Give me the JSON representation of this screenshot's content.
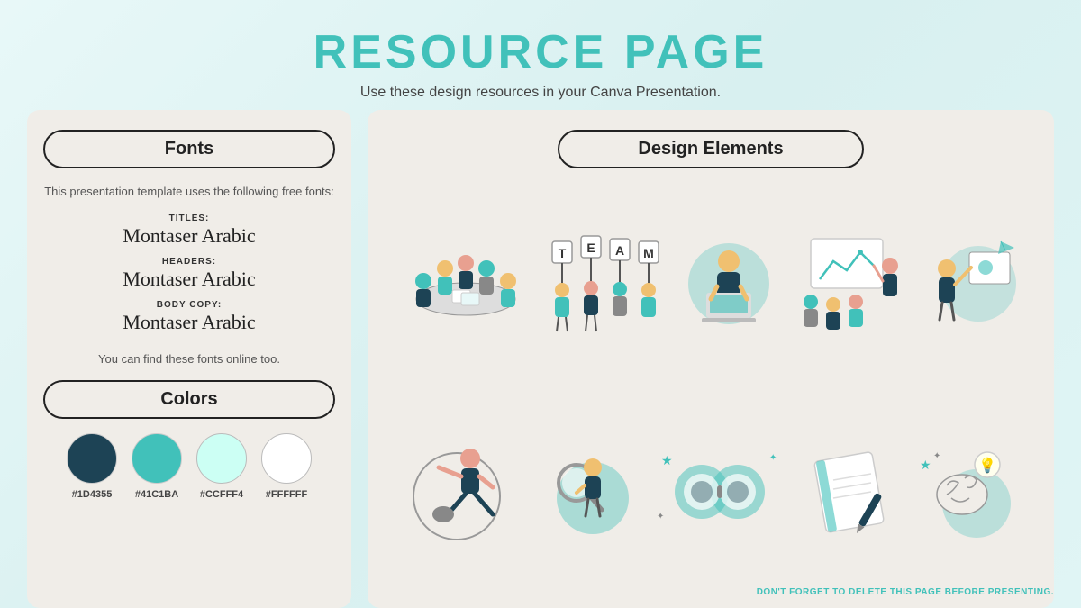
{
  "header": {
    "title": "RESOURCE PAGE",
    "subtitle": "Use these design resources in your Canva Presentation."
  },
  "left_panel": {
    "fonts_section": {
      "label": "Fonts",
      "intro": "This presentation template uses the following free fonts:",
      "entries": [
        {
          "label": "TITLES:",
          "name": "Montaser Arabic"
        },
        {
          "label": "HEADERS:",
          "name": "Montaser Arabic"
        },
        {
          "label": "BODY COPY:",
          "name": "Montaser Arabic"
        }
      ],
      "footer": "You can find these fonts online too."
    },
    "colors_section": {
      "label": "Colors",
      "swatches": [
        {
          "hex": "#1D4355",
          "label": "#1D4355"
        },
        {
          "hex": "#41C1BA",
          "label": "#41C1BA"
        },
        {
          "hex": "#CCFFF4",
          "label": "#CCFFF4"
        },
        {
          "hex": "#FFFFFF",
          "label": "#FFFFFF"
        }
      ]
    }
  },
  "right_panel": {
    "label": "Design Elements"
  },
  "footer": {
    "note": "DON'T FORGET TO DELETE THIS PAGE BEFORE PRESENTING."
  }
}
